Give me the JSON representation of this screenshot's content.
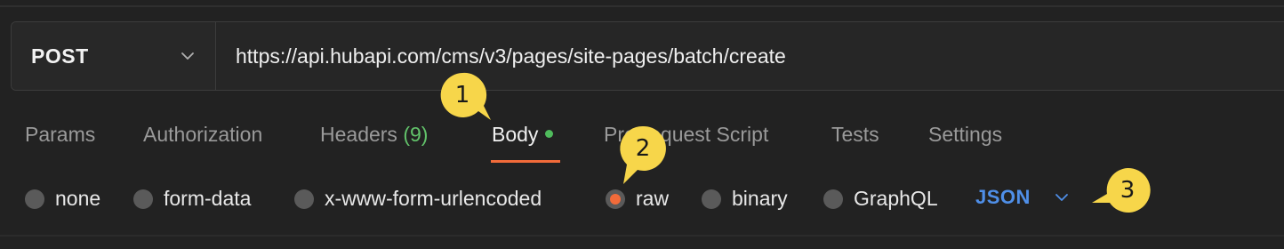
{
  "request": {
    "method": "POST",
    "url": "https://api.hubapi.com/cms/v3/pages/site-pages/batch/create"
  },
  "tabs": [
    {
      "label": "Params"
    },
    {
      "label": "Authorization"
    },
    {
      "label": "Headers",
      "count": "(9)"
    },
    {
      "label": "Body"
    },
    {
      "label": "Pre-request Script"
    },
    {
      "label": "Tests"
    },
    {
      "label": "Settings"
    }
  ],
  "active_tab": "Body",
  "body_modes": [
    {
      "label": "none"
    },
    {
      "label": "form-data"
    },
    {
      "label": "x-www-form-urlencoded"
    },
    {
      "label": "raw"
    },
    {
      "label": "binary"
    },
    {
      "label": "GraphQL"
    }
  ],
  "selected_body_mode": "raw",
  "raw_format": "JSON",
  "callouts": [
    "1",
    "2",
    "3"
  ],
  "colors": {
    "accent": "#f26b3a",
    "format_blue": "#4f8fe8",
    "headers_count_green": "#62c26a",
    "callout_yellow": "#f7d64a"
  }
}
